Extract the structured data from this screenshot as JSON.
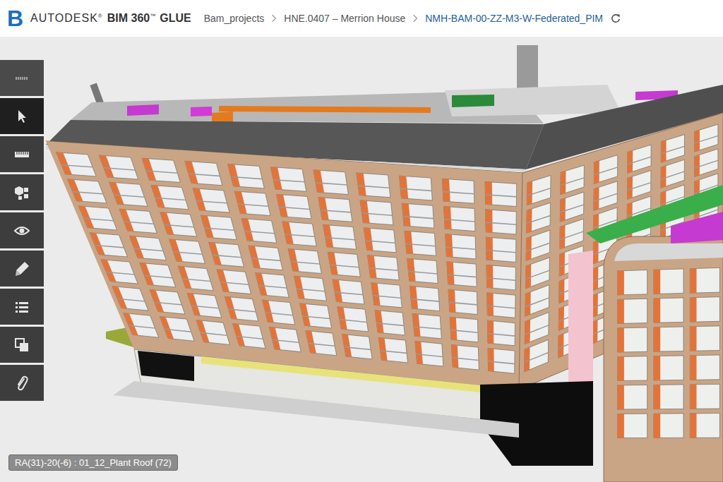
{
  "header": {
    "logo": "B",
    "brand": "AUTODESK",
    "brand_mark": "®",
    "product": "BIM 360",
    "product_mark": "™",
    "edition": "GLUE"
  },
  "breadcrumbs": [
    {
      "label": "Bam_projects",
      "current": false
    },
    {
      "label": "HNE.0407 – Merrion House",
      "current": false
    },
    {
      "label": "NMH-BAM-00-ZZ-M3-W-Federated_PIM",
      "current": true
    }
  ],
  "toolbar": [
    {
      "kind": "grip",
      "selected": false
    },
    {
      "kind": "select",
      "selected": true
    },
    {
      "kind": "measure",
      "selected": false
    },
    {
      "kind": "explode",
      "selected": false
    },
    {
      "kind": "view",
      "selected": false
    },
    {
      "kind": "markup",
      "selected": false
    },
    {
      "kind": "list",
      "selected": false
    },
    {
      "kind": "layers",
      "selected": false
    },
    {
      "kind": "attach",
      "selected": false
    }
  ],
  "status_label": "RA(31)-20(-6) : 01_12_Plant Roof (72)"
}
